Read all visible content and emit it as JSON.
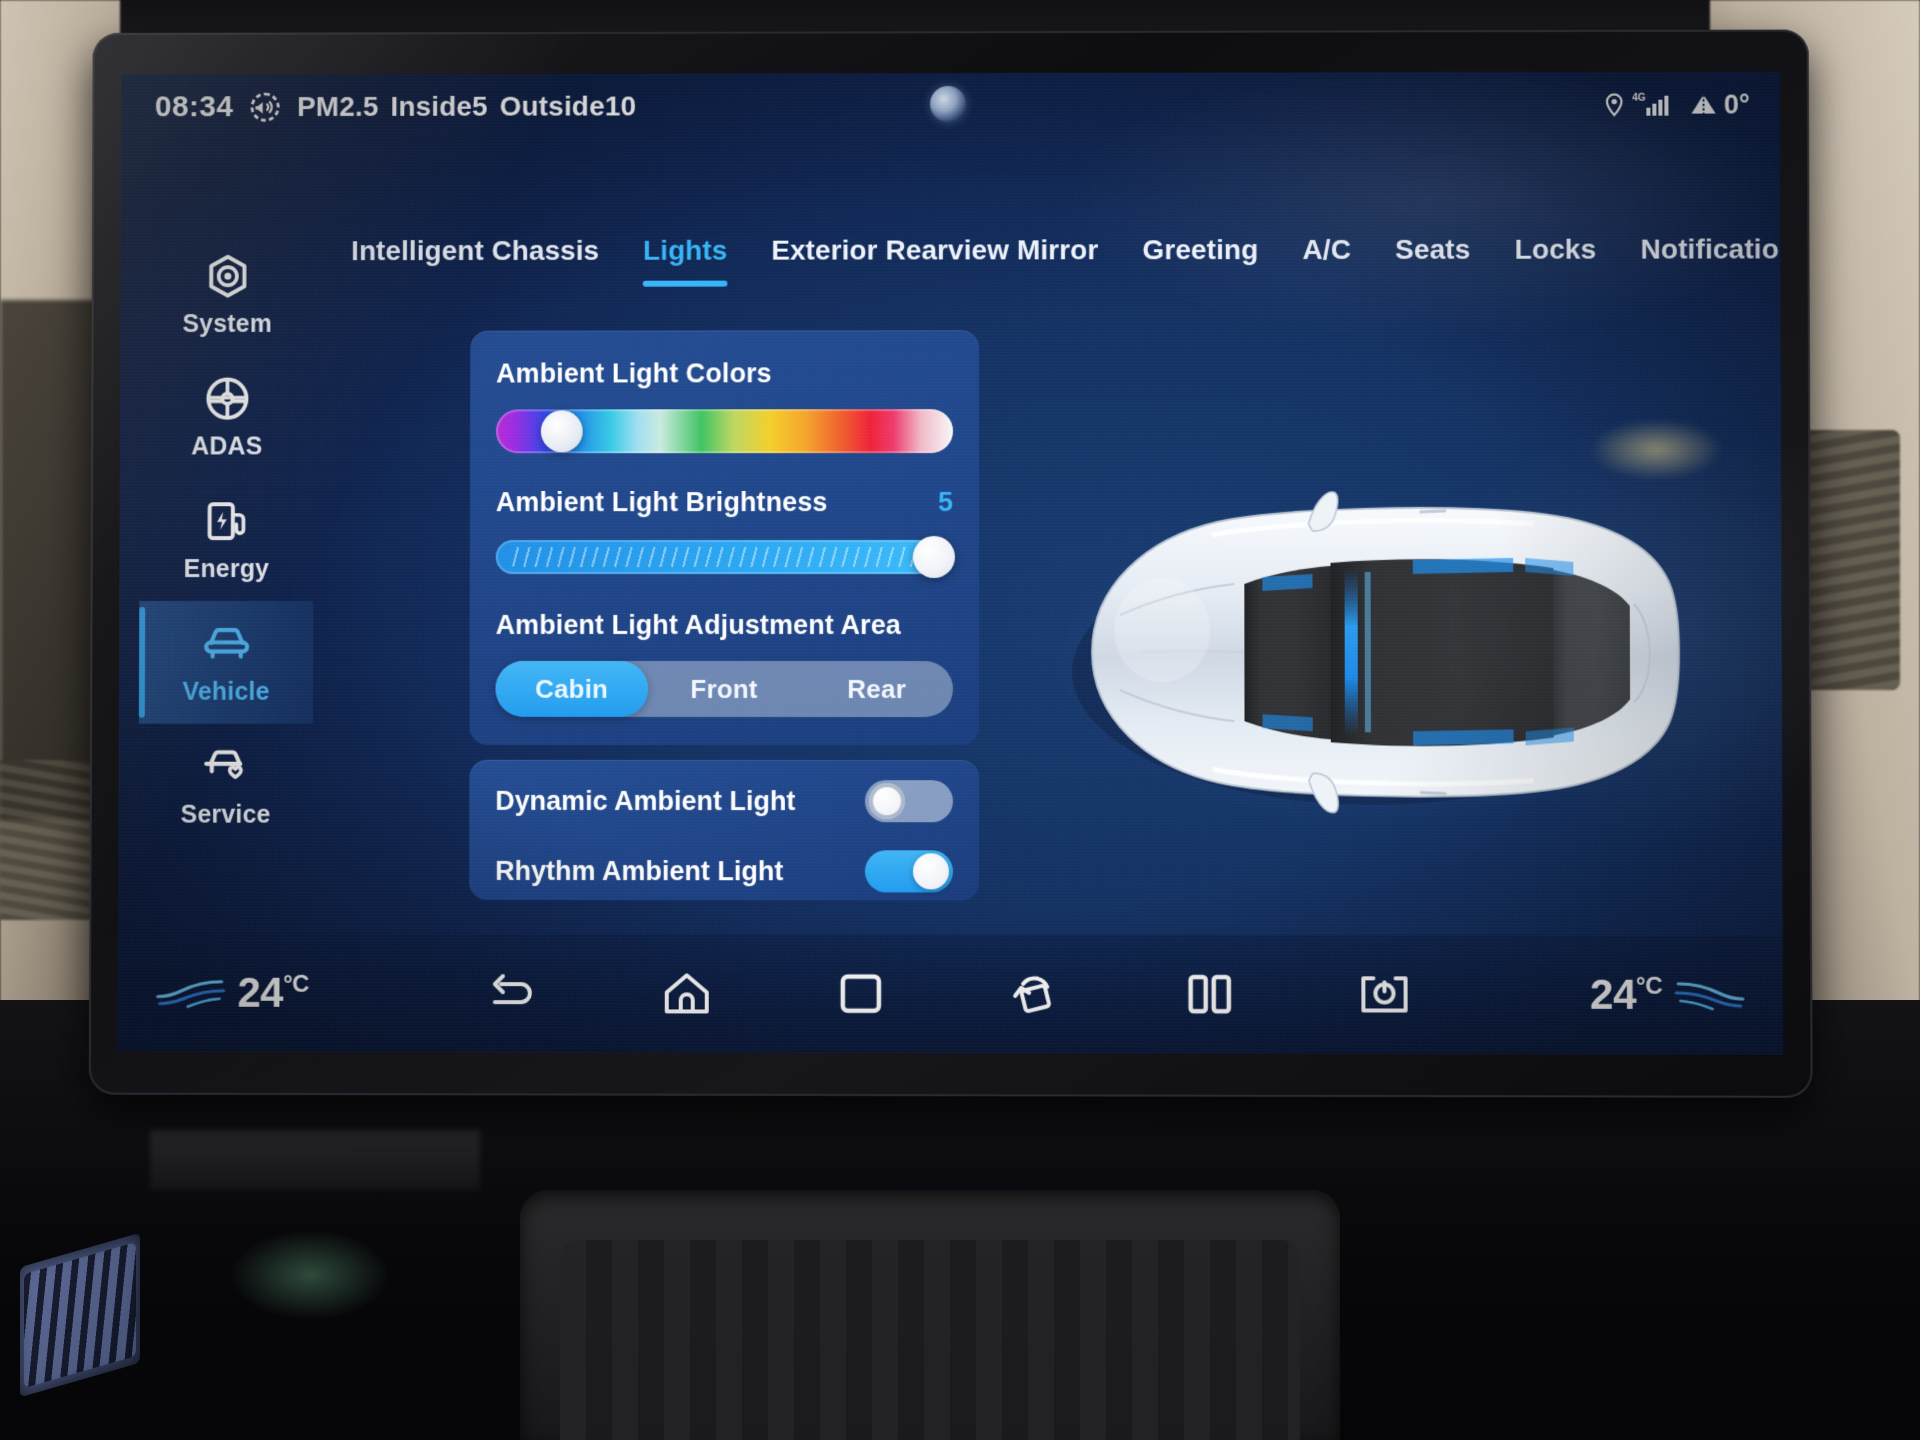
{
  "statusbar": {
    "time": "08:34",
    "air_icon": "air-quality-icon",
    "pm_label": "PM2.5",
    "inside_label": "Inside",
    "inside_value": "5",
    "outside_label": "Outside",
    "outside_value": "10",
    "location_icon": "location-pin-icon",
    "network_label": "4G",
    "signal_icon": "signal-bars-icon",
    "heading_icon": "compass-cone-icon",
    "heading_value": "0°",
    "camera_icon": "front-camera-icon"
  },
  "sidebar": {
    "items": [
      {
        "label": "System",
        "icon": "system-hex-icon",
        "active": false
      },
      {
        "label": "ADAS",
        "icon": "steering-wheel-icon",
        "active": false
      },
      {
        "label": "Energy",
        "icon": "charging-station-icon",
        "active": false
      },
      {
        "label": "Vehicle",
        "icon": "car-front-icon",
        "active": true
      },
      {
        "label": "Service",
        "icon": "car-heart-icon",
        "active": false
      }
    ]
  },
  "tabs": [
    {
      "label": "Intelligent Chassis",
      "active": false
    },
    {
      "label": "Lights",
      "active": true
    },
    {
      "label": "Exterior Rearview Mirror",
      "active": false
    },
    {
      "label": "Greeting",
      "active": false
    },
    {
      "label": "A/C",
      "active": false
    },
    {
      "label": "Seats",
      "active": false
    },
    {
      "label": "Locks",
      "active": false
    },
    {
      "label": "Notifications",
      "active": false
    }
  ],
  "settings": {
    "ambient_colors": {
      "title": "Ambient Light Colors",
      "thumb_percent": 14.5
    },
    "ambient_brightness": {
      "title": "Ambient Light Brightness",
      "value": "5",
      "fill_percent": 100
    },
    "adjustment_area": {
      "title": "Ambient Light Adjustment Area",
      "options": [
        {
          "label": "Cabin",
          "active": true
        },
        {
          "label": "Front",
          "active": false
        },
        {
          "label": "Rear",
          "active": false
        }
      ]
    },
    "toggles": [
      {
        "label": "Dynamic Ambient Light",
        "on": false
      },
      {
        "label": "Rhythm Ambient Light",
        "on": true
      }
    ]
  },
  "car_preview": {
    "view": "top-down-sedan",
    "body_color": "#e9eef5",
    "glass_color": "#2c2c30",
    "ambient_strip_color": "#1b8ef0"
  },
  "navbar": {
    "temp_left": "24",
    "temp_left_unit": "°C",
    "temp_right": "24",
    "temp_right_unit": "°C",
    "icons": [
      {
        "name": "back-icon"
      },
      {
        "name": "home-icon"
      },
      {
        "name": "recents-icon"
      },
      {
        "name": "screen-rotate-icon"
      },
      {
        "name": "split-screen-icon"
      },
      {
        "name": "screen-off-icon"
      }
    ]
  },
  "colors": {
    "accent": "#35b4f7",
    "panel": "#2856a5",
    "page_bg": "#123163",
    "text": "#ffffff"
  }
}
